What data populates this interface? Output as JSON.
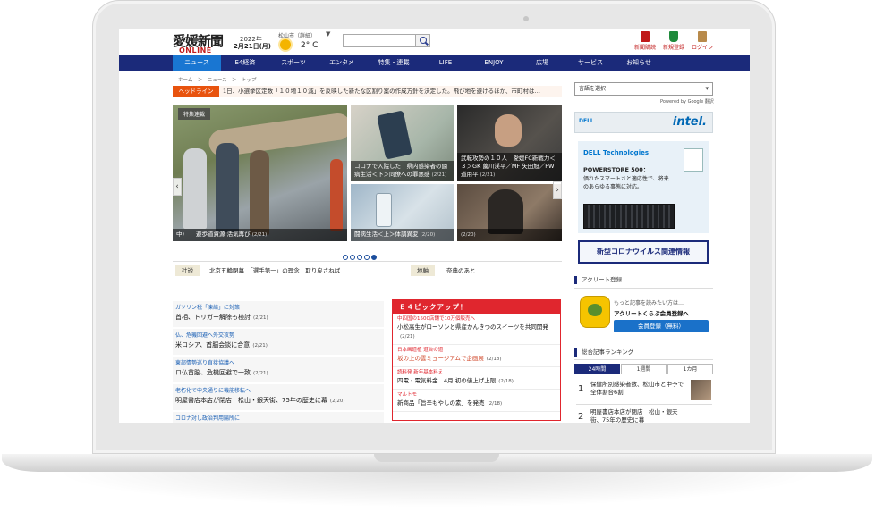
{
  "header": {
    "logo_main": "愛媛新聞",
    "logo_sub": "ONLINE",
    "year": "2022年",
    "date": "2月21日(月)",
    "city": "松山市（詳細）",
    "temperature": "2° C",
    "caret": "▼",
    "search": {
      "placeholder": ""
    },
    "links": [
      {
        "label": "新聞購読",
        "icon": "newspaper-icon"
      },
      {
        "label": "新規登録",
        "icon": "beginner-mark-icon"
      },
      {
        "label": "ログイン",
        "icon": "door-icon"
      }
    ]
  },
  "nav": {
    "items": [
      "ニュース",
      "E4経済",
      "スポーツ",
      "エンタメ",
      "特集・連載",
      "LIFE",
      "ENJOY",
      "広場",
      "サービス",
      "お知らせ"
    ],
    "active_index": 0
  },
  "breadcrumb": "ホーム　＞　ニュース　＞　トップ",
  "ticker": {
    "tag": "ヘッドライン",
    "text": "1日、小選挙区定数「１０増１０減」を反映した新たな区割り案の作成方針を決定した。飛び地を避けるほか、市町村は…"
  },
  "carousel": {
    "main": {
      "tag": "特集連載",
      "caption": "中)　　避歩道資源 活気再び",
      "date": "(2/21)"
    },
    "tiles": [
      {
        "caption": "コロナで入院した　県内感染者の闘病生活＜下＞同僚への罪悪感",
        "date": "(2/21)"
      },
      {
        "caption": "武転攻勢の１０人　愛媛FC新戦力＜３＞GK 薗川渓平／MF 矢田旭／FW 道用平",
        "date": "(2/21)"
      },
      {
        "caption": "闘病生活＜上＞体調異変",
        "date": "(2/20)"
      },
      {
        "caption": "",
        "date": "(2/20)"
      }
    ],
    "prev": "‹",
    "next": "›",
    "dot_count": 5,
    "active_dot": 4
  },
  "editorial": {
    "tag1": "社説",
    "text1": "北京五輪閉幕　「選手第一」の理念　取り戻さねば",
    "tag2": "地軸",
    "text2": "奈典のあと"
  },
  "news_list": [
    {
      "category": "ガソリン税「凍結」に対策",
      "title": "首相、トリガー解除も検討",
      "date": "(2/21)"
    },
    {
      "category": "仏、危機回避へ外交攻勢",
      "title": "米ロシア、首脳会談に合意",
      "date": "(2/21)"
    },
    {
      "category": "東部情勢巡り直接協議へ",
      "title": "ロ仏首脳、危機回避で一致",
      "date": "(2/21)"
    },
    {
      "category": "老朽化で中央通りに機能移転へ",
      "title": "明屋書店本店が閉店　松山・銀天街、75年の歴史に幕",
      "date": "(2/20)"
    },
    {
      "category": "コロナ対し政治判用陽所に",
      "title": "",
      "date": ""
    }
  ],
  "e4_pickup": {
    "title": "Ｅ４ピックアップ！",
    "items": [
      {
        "category": "中四国の1500店舗で10万個販売へ",
        "title": "小松高生がローソンと県産かんきつのスイーツを共同開発",
        "date": "(2/21)",
        "red": false
      },
      {
        "category": "日本画道植 道台の道",
        "title": "坂の上の雲ミュージアムで企画展",
        "date": "(2/18)",
        "red": true
      },
      {
        "category": "読料発 新年基本料え",
        "title": "四電・電気料金　4月 初の値上げ上限",
        "date": "(2/18)",
        "red": false
      },
      {
        "category": "マルトモ",
        "title": "新商品「旨辛もやしの素」を発売",
        "date": "(2/18)",
        "red": false
      }
    ]
  },
  "sidebar": {
    "language": "言語を選択",
    "powered": "Powered by Google 翻訳",
    "ad1": {
      "brand": "DELL",
      "chip": "intel."
    },
    "ad2": {
      "brand": "DELL Technologies",
      "line1": "POWERSTORE 500：",
      "line2": "価れたスマートさと適応性で、将来のあらゆる事態に対応。"
    },
    "covid": "新型コロナウイルス関連情報",
    "acc_title": "アクリート登録",
    "acc_line1": "もっと記事を読みたい方は…",
    "acc_line2": "アクリートくらぶ会員登録へ",
    "member_button": "会員登録（無料）",
    "ranking_title": "総合記事ランキング",
    "tabs": [
      "24時間",
      "1週間",
      "1カ月"
    ],
    "active_tab": 0,
    "ranking": [
      {
        "rank": "1",
        "text": "保健所別感染者数、松山市と中予で全体割合6割"
      },
      {
        "rank": "2",
        "text": "明屋書店本店が閉店　松山・銀天街、75年の歴史に幕"
      }
    ]
  },
  "colors": {
    "nav": "#1b2a7a",
    "nav_active": "#1976d2",
    "ticker_tag": "#e8530e",
    "e4": "#e0262e"
  }
}
